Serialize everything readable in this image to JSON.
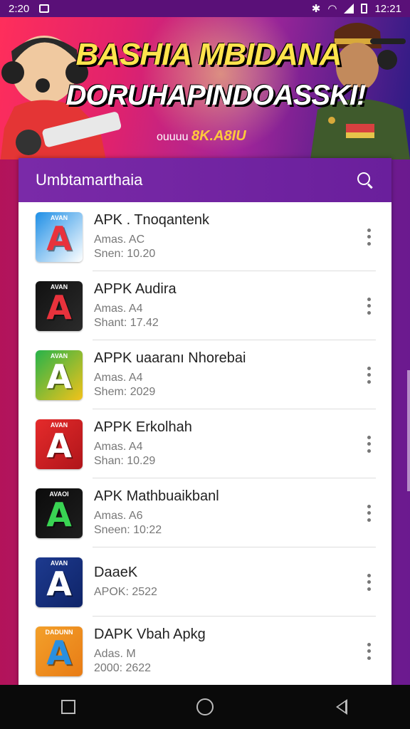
{
  "status_bar": {
    "time_left": "2:20",
    "time_right": "12:21"
  },
  "banner": {
    "title_line1": "BASHIA MBIDANA",
    "title_line2": "DORUHAPINDOASSKI!",
    "subtitle_prefix": "ouuuu",
    "subtitle_highlight": "8K.A8IU"
  },
  "panel": {
    "title": "Umbtamarthaia"
  },
  "apps": [
    {
      "name": "APK . Tnoqantenk",
      "line1": "Amas. AC",
      "line2": "Snen: 10.20",
      "colors": [
        "#1f8fe6",
        "#ffffff"
      ],
      "accent": "#e8323c",
      "icon_label": "AVAN"
    },
    {
      "name": "APPK Audira",
      "line1": "Amas. A4",
      "line2": "Shant: 17.42",
      "colors": [
        "#111111",
        "#2b2b2b"
      ],
      "accent": "#e8323c",
      "icon_label": "AVAN"
    },
    {
      "name": "APPK uaaranı Nhorebai",
      "line1": "Amas. A4",
      "line2": "Shem: 2029",
      "colors": [
        "#27b34a",
        "#f2c21a"
      ],
      "accent": "#ffffff",
      "icon_label": "AVAN"
    },
    {
      "name": "APPK Erkolhah",
      "line1": "Amas. A4",
      "line2": "Shan: 10.29",
      "colors": [
        "#e52b2b",
        "#b0151a"
      ],
      "accent": "#ffffff",
      "icon_label": "AVAN"
    },
    {
      "name": "APK Mathbuaikbanl",
      "line1": "Amas. A6",
      "line2": "Sneen: 10:22",
      "colors": [
        "#0b0b0b",
        "#1e1e1e"
      ],
      "accent": "#39d453",
      "icon_label": "AVAOI"
    },
    {
      "name": "DaaeK",
      "line1": "APOK: 2522",
      "line2": "",
      "colors": [
        "#1d3a8f",
        "#0f2468"
      ],
      "accent": "#ffffff",
      "icon_label": "AVAN"
    },
    {
      "name": "DAPK Vbah Apkg",
      "line1": "Adas. M",
      "line2": "2000: 2622",
      "colors": [
        "#f3a02a",
        "#e87c16"
      ],
      "accent": "#2a8fe0",
      "icon_label": "DADUNN"
    }
  ]
}
